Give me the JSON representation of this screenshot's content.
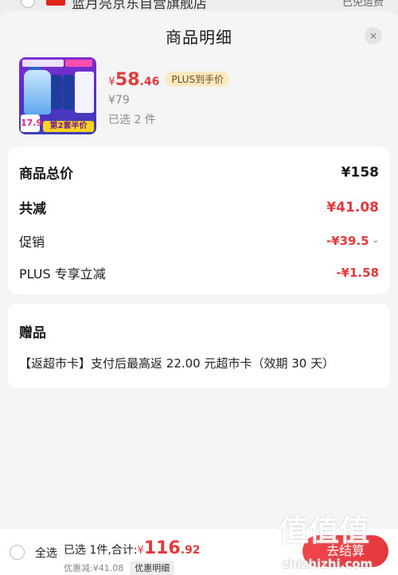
{
  "background": {
    "store_name": "蓝月亮京东自营旗舰店",
    "right_text": "已免运费"
  },
  "sheet": {
    "title": "商品明细",
    "close_icon": "×"
  },
  "product": {
    "image_badge_number": "17.9",
    "image_tag": "第2套半价",
    "price_currency": "¥",
    "price_int": "58",
    "price_dec": ".46",
    "plus_badge": "PLUS到手价",
    "original_price": "¥79",
    "selected_qty": "已选 2 件"
  },
  "price_card": {
    "total_label": "商品总价",
    "total_value": "¥158",
    "reduce_label": "共减",
    "reduce_value": "¥41.08",
    "promo_label": "促销",
    "promo_value": "-¥39.5",
    "plus_label": "PLUS 专享立减",
    "plus_value": "-¥1.58"
  },
  "gift_card": {
    "title": "赠品",
    "text": "【返超市卡】支付后最高返 22.00 元超市卡（效期 30 天）"
  },
  "bottom_bar": {
    "select_all": "全选",
    "summary_prefix": "已选 1件,合计:",
    "summary_currency": "¥",
    "summary_int": "116",
    "summary_dec": ".92",
    "discount_text": "优惠减:¥41.08",
    "detail_button": "优惠明细",
    "checkout_button": "去结算"
  },
  "watermark": {
    "logo": "值值值",
    "url": "zhizhizhi.com"
  },
  "colors": {
    "accent_red": "#e4393c",
    "plus_badge_bg": "#ffe9c0"
  }
}
